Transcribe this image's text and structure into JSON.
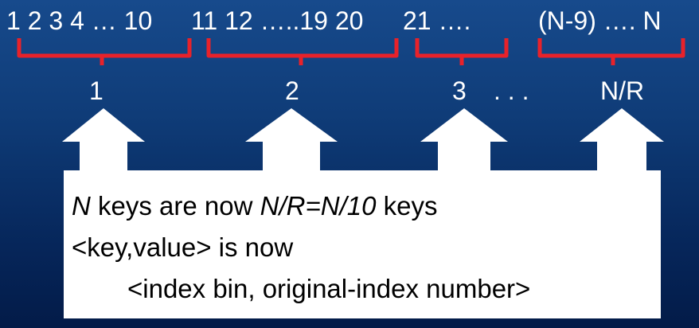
{
  "sequence_groups": [
    {
      "text": "1 2 3 4 … 10"
    },
    {
      "text": "11 12 …..19 20"
    },
    {
      "text": "21 …."
    },
    {
      "text": "(N-9) …. N"
    }
  ],
  "bin_labels": [
    "1",
    "2",
    "3",
    "N/R"
  ],
  "ellipsis": ". . .",
  "colors": {
    "background_top": "#174a8c",
    "background_bottom": "#031b48",
    "brace": "#e8222a",
    "text_light": "#ffffff",
    "box_fill": "#ffffff",
    "text_dark": "#000000"
  },
  "message": {
    "line1": {
      "n": "N",
      "mid1": " keys are now ",
      "ratio": "N/R=N/10",
      "end": " keys"
    },
    "line2": "<key,value> is now",
    "line3": "<index bin, original-index number>"
  }
}
